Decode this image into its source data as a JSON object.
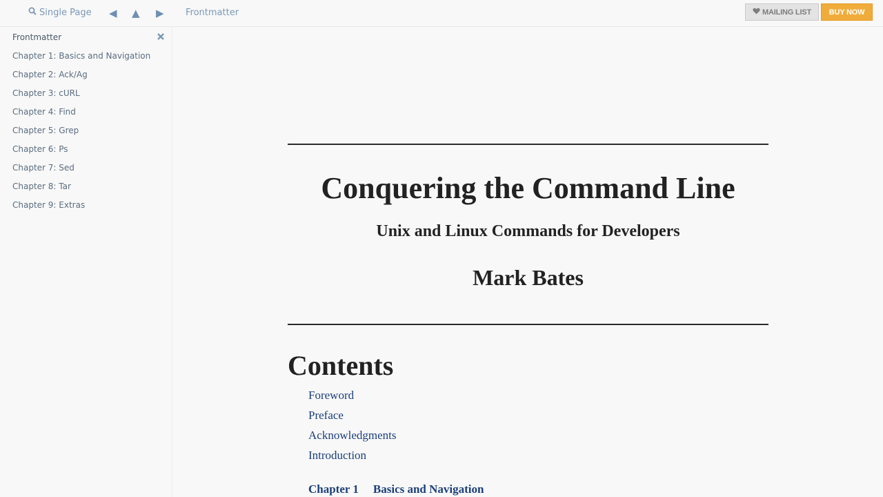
{
  "topbar": {
    "single_page": "Single Page",
    "prev_glyph": "◀",
    "up_glyph": "▲",
    "next_glyph": "▶",
    "breadcrumb": "Frontmatter",
    "mailing_list": "MAILING LIST",
    "buy_now": "BUY NOW"
  },
  "sidebar": {
    "items": [
      "Frontmatter",
      "Chapter 1: Basics and Navigation",
      "Chapter 2: Ack/Ag",
      "Chapter 3: cURL",
      "Chapter 4: Find",
      "Chapter 5: Grep",
      "Chapter 6: Ps",
      "Chapter 7: Sed",
      "Chapter 8: Tar",
      "Chapter 9: Extras"
    ]
  },
  "book": {
    "title": "Conquering the Command Line",
    "subtitle": "Unix and Linux Commands for Developers",
    "author": "Mark Bates"
  },
  "toc": {
    "heading": "Contents",
    "links": [
      "Foreword",
      "Preface",
      "Acknowledgments",
      "Introduction"
    ],
    "chapter_number": "Chapter 1",
    "chapter_title": "Basics and Navigation"
  },
  "colors": {
    "link": "#1a3f7a",
    "buy_button": "#f0ac3b",
    "nav": "#7a98b8"
  }
}
